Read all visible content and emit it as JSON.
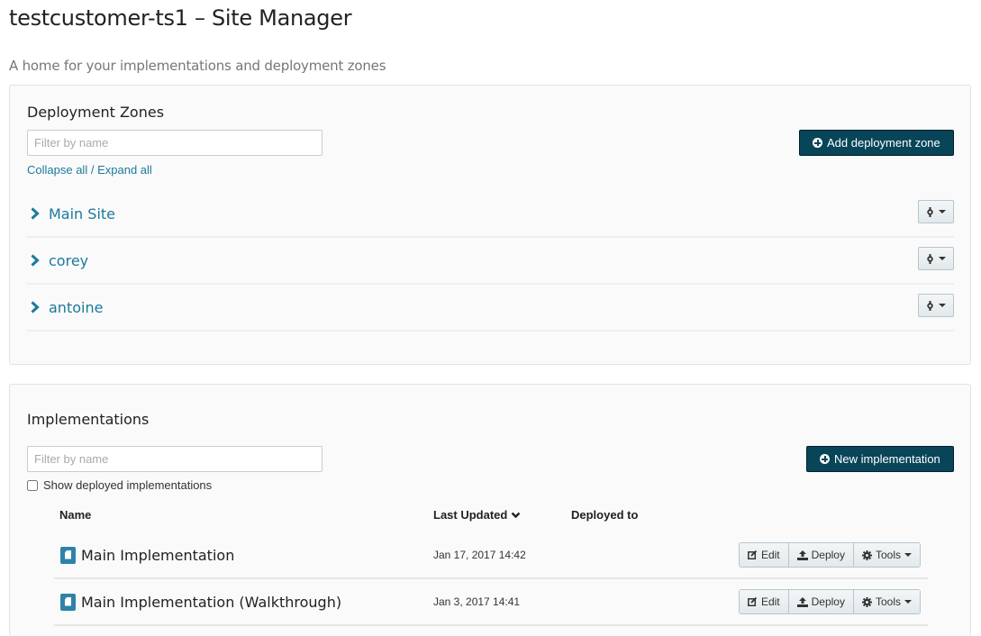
{
  "header": {
    "title": "testcustomer-ts1 – Site Manager",
    "subtitle": "A home for your implementations and deployment zones"
  },
  "deployment_zones": {
    "title": "Deployment Zones",
    "filter_placeholder": "Filter by name",
    "filter_value": "",
    "collapse_all": "Collapse all",
    "separator": "/",
    "expand_all": "Expand all",
    "add_button": "Add deployment zone",
    "zones": [
      {
        "name": "Main Site",
        "expanded": false
      },
      {
        "name": "corey",
        "expanded": false
      },
      {
        "name": "antoine",
        "expanded": false
      }
    ]
  },
  "implementations": {
    "title": "Implementations",
    "filter_placeholder": "Filter by name",
    "filter_value": "",
    "show_deployed_label": "Show deployed implementations",
    "show_deployed_checked": false,
    "new_button": "New implementation",
    "columns": {
      "name": "Name",
      "last_updated": "Last Updated",
      "deployed_to": "Deployed to"
    },
    "sort": {
      "column": "last_updated",
      "direction": "desc"
    },
    "rows": [
      {
        "name": "Main Implementation",
        "last_updated": "Jan 17, 2017 14:42",
        "deployed_to": ""
      },
      {
        "name": "Main Implementation (Walkthrough)",
        "last_updated": "Jan 3, 2017 14:41",
        "deployed_to": ""
      }
    ],
    "row_actions": {
      "edit": "Edit",
      "deploy": "Deploy",
      "tools": "Tools"
    }
  },
  "colors": {
    "primary_button": "#084559",
    "link": "#1a7a9c",
    "doc_icon": "#2e82a8",
    "panel_bg": "#fafafa"
  }
}
